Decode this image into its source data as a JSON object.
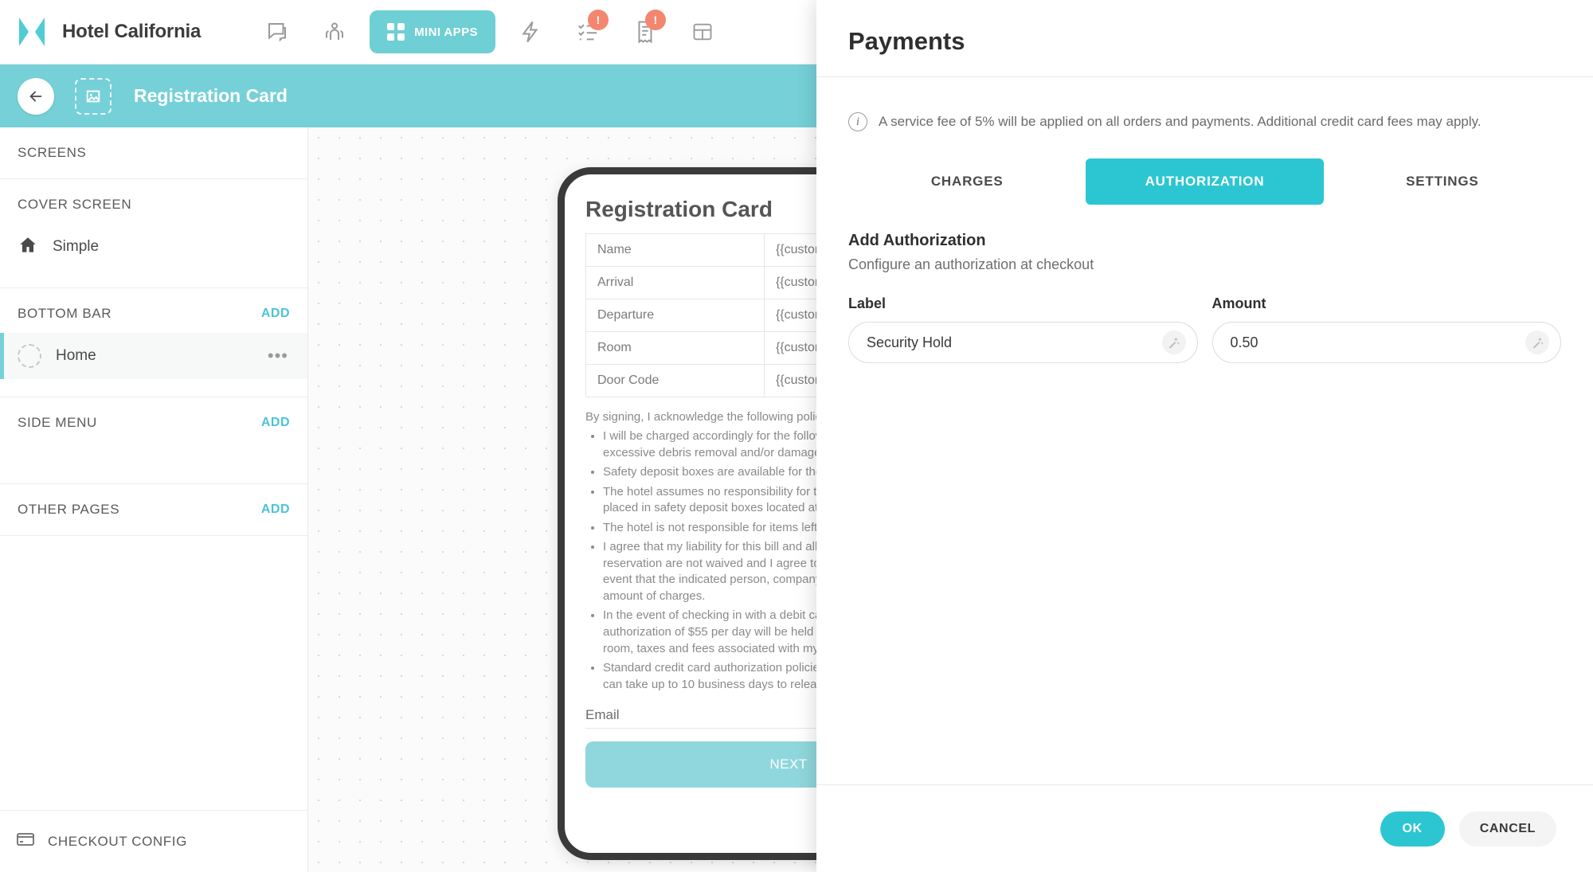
{
  "colors": {
    "brand_teal": "#76d0d8",
    "accent_teal": "#2cc6d2",
    "badge_orange": "#f4866f",
    "link_blue": "#4cc3d9"
  },
  "topbar": {
    "brand": "Hotel California",
    "mini_apps_label": "MINI APPS",
    "icons": [
      {
        "name": "chat-icon",
        "badge": ""
      },
      {
        "name": "guests-icon",
        "badge": ""
      },
      {
        "name": "bolt-icon",
        "badge": ""
      },
      {
        "name": "tasks-icon",
        "badge": "!"
      },
      {
        "name": "receipt-icon",
        "badge": "!"
      },
      {
        "name": "table-icon",
        "badge": ""
      }
    ]
  },
  "subheader": {
    "title": "Registration Card"
  },
  "sidebar": {
    "screens_label": "SCREENS",
    "sections": [
      {
        "label": "COVER SCREEN",
        "add": "",
        "items": [
          {
            "label": "Simple",
            "icon": "home-icon",
            "selected": false
          }
        ]
      },
      {
        "label": "BOTTOM BAR",
        "add": "ADD",
        "items": [
          {
            "label": "Home",
            "icon": "dashed-circle-icon",
            "selected": true,
            "menu": "•••"
          }
        ]
      },
      {
        "label": "SIDE MENU",
        "add": "ADD",
        "items": []
      },
      {
        "label": "OTHER PAGES",
        "add": "ADD",
        "items": []
      }
    ],
    "footer": {
      "label": "CHECKOUT CONFIG",
      "icon": "credit-card-icon"
    }
  },
  "preview": {
    "card_title": "Registration Card",
    "rows": [
      {
        "key": "Name",
        "value": "{{customer.full_name}}"
      },
      {
        "key": "Arrival",
        "value": "{{customer.check_in}}"
      },
      {
        "key": "Departure",
        "value": "{{customer.checkout}}"
      },
      {
        "key": "Room",
        "value": "{{customer.room_number}}"
      },
      {
        "key": "Door Code",
        "value": "{{custom.door_code}}"
      }
    ],
    "policy_intro": "By signing, I acknowledge the following policies:",
    "policies": [
      "I will be charged accordingly for the following: smoking in a guest room, excessive debris removal and/or damage to the guest room",
      "Safety deposit boxes are available for the security of valuables.",
      "The hotel assumes no responsibility for the loss of valuables unless placed in safety deposit boxes located at the Front Desk.",
      "The hotel is not responsible for items left in guest rooms after departure.",
      "I agree that my liability for this bill and all charges associated with this reservation are not waived and I agree to be held personally liable in the event that the indicated person, company, or group fails to pay the full amount of charges.",
      "In the event of checking in with a debit card, I understand that an authorization of $55 per day will be held in addition to the total expected room, taxes and fees associated with my stay.",
      "Standard credit card authorization policies vary from bank to bank, and can take up to 10 business days to release."
    ],
    "email_label": "Email",
    "next_label": "NEXT"
  },
  "panel": {
    "title": "Payments",
    "notice": "A service fee of 5% will be applied on all orders and payments. Additional credit card fees may apply.",
    "tabs": [
      {
        "label": "CHARGES",
        "active": false
      },
      {
        "label": "AUTHORIZATION",
        "active": true
      },
      {
        "label": "SETTINGS",
        "active": false
      }
    ],
    "section_title": "Add Authorization",
    "section_sub": "Configure an authorization at checkout",
    "fields": [
      {
        "label": "Label",
        "value": "Security Hold",
        "placeholder": ""
      },
      {
        "label": "Amount",
        "value": "0.50",
        "placeholder": ""
      }
    ],
    "ok_label": "OK",
    "cancel_label": "CANCEL"
  }
}
